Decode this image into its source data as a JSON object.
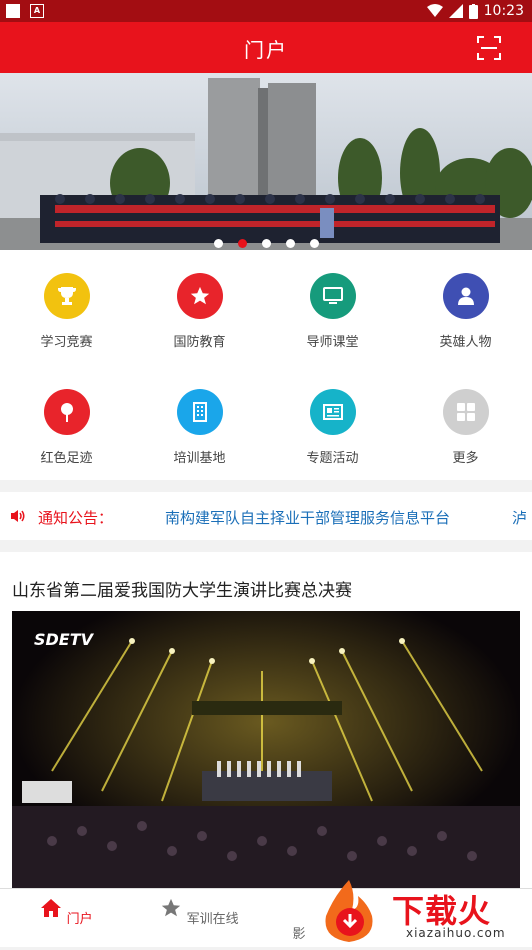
{
  "status_bar": {
    "time": "10:23"
  },
  "app_bar": {
    "title": "门户",
    "scan_icon": "scan-icon"
  },
  "banner": {
    "dot_count": 5,
    "active_index": 1
  },
  "grid": {
    "items": [
      {
        "label": "学习竞赛",
        "icon": "trophy-icon",
        "color": "#f2c20f"
      },
      {
        "label": "国防教育",
        "icon": "star-icon",
        "color": "#e8242b"
      },
      {
        "label": "导师课堂",
        "icon": "monitor-icon",
        "color": "#169b7c"
      },
      {
        "label": "英雄人物",
        "icon": "person-icon",
        "color": "#3f4fb3"
      },
      {
        "label": "红色足迹",
        "icon": "pin-icon",
        "color": "#e8242b"
      },
      {
        "label": "培训基地",
        "icon": "building-icon",
        "color": "#1aa6ea"
      },
      {
        "label": "专题活动",
        "icon": "newspaper-icon",
        "color": "#16b3c9"
      },
      {
        "label": "更多",
        "icon": "grid-more-icon",
        "color": "#cfcfcf"
      }
    ]
  },
  "notice": {
    "label": "通知公告：",
    "text": "南构建军队自主择业干部管理服务信息平台",
    "overflow_text": "泸"
  },
  "news": {
    "title": "山东省第二届爱我国防大学生演讲比赛总决赛",
    "image_logo": "SDETV"
  },
  "tabs": [
    {
      "label": "门户",
      "icon": "home-icon",
      "active": true
    },
    {
      "label": "军训在线",
      "icon": "star-outline-icon",
      "active": false
    },
    {
      "label": "影",
      "icon": "",
      "active": false
    }
  ],
  "watermark": {
    "text": "下载火",
    "sub": "xiazaihuo.com"
  },
  "colors": {
    "primary": "#e8131c",
    "status_bar": "#a30d12",
    "link": "#1b6fb8"
  }
}
